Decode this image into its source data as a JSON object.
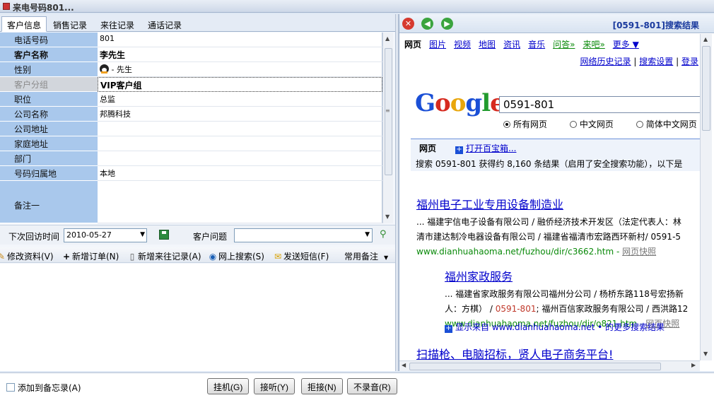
{
  "window": {
    "title": "来电号码801..."
  },
  "tabs": [
    {
      "label": "客户信息",
      "active": true
    },
    {
      "label": "销售记录",
      "active": false
    },
    {
      "label": "来往记录",
      "active": false
    },
    {
      "label": "通话记录",
      "active": false
    }
  ],
  "customer": {
    "phone": {
      "label": "电话号码",
      "value": "801"
    },
    "name": {
      "label": "客户名称",
      "value": "李先生"
    },
    "gender": {
      "label": "性别",
      "value": "- 先生"
    },
    "group": {
      "label": "客户分组",
      "value": "VIP客户组"
    },
    "title": {
      "label": "职位",
      "value": "总监"
    },
    "company": {
      "label": "公司名称",
      "value": "邦腾科技"
    },
    "company_address": {
      "label": "公司地址",
      "value": ""
    },
    "home_address": {
      "label": "家庭地址",
      "value": ""
    },
    "department": {
      "label": "部门",
      "value": ""
    },
    "location": {
      "label": "号码归属地",
      "value": "本地"
    },
    "note1": {
      "label": "备注一",
      "value": ""
    }
  },
  "followup": {
    "next_visit_label": "下次回访时间",
    "next_visit_value": "2010-05-27",
    "issue_label": "客户问题",
    "issue_value": ""
  },
  "toolbar": {
    "edit": "修改资料(V)",
    "new_order": "新增订单(N)",
    "new_record": "新增来往记录(A)",
    "web_search": "网上搜索(S)",
    "send_sms": "发送短信(F)",
    "common_notes": "常用备注"
  },
  "browser": {
    "header_title": "[0591-801]搜索结果",
    "nav": {
      "web": "网页",
      "images": "图片",
      "video": "视频",
      "maps": "地图",
      "news": "资讯",
      "music": "音乐",
      "qa": "问答»",
      "laiba": "来吧»",
      "more": "更多 ▼"
    },
    "history": "网络历史记录",
    "settings": "搜索设置",
    "login": "登录",
    "sep": "|",
    "query": "0591-801",
    "radio_all": "所有网页",
    "radio_cn": "中文网页",
    "radio_sc": "简体中文网页",
    "results_tab": "网页",
    "toolbox": "打开百宝箱...",
    "stats": "搜索  0591-801 获得约  8,160 条结果（启用了安全搜索功能），以下是",
    "results": [
      {
        "title": "福州电子工业专用设备制造业",
        "line1": "... 福建宇信电子设备有限公司  / 融侨经济技术开发区（法定代表人：林",
        "line2": "清市建达制冷电器设备有限公司  / 福建省福清市宏路西环新村/ 0591-5",
        "url": "www.dianhuahaoma.net/fuzhou/dir/c3662.htm",
        "cache": "网页快照"
      },
      {
        "title": "福州家政服务",
        "line1": "... 福建省家政服务有限公司福州分公司  / 杨桥东路118号宏扬新",
        "line2a": "人：方棋）  / ",
        "line2hl": "0591-801",
        "line2b": "; 福州百信家政服务有限公司  / 西洪路12",
        "url": "www.dianhuahaoma.net/fuzhou/dir/o821.htm",
        "cache": "网页快照"
      },
      {
        "title": "扫描枪、电脑招标，贤人电子商务平台!"
      }
    ],
    "more_results": "显示来自  www.dianhuahaoma.net • 的更多搜索结果"
  },
  "bottom": {
    "memo": "添加到备忘录(A)",
    "hangup": "挂机(G)",
    "answer": "接听(Y)",
    "reject": "拒接(N)",
    "norecord": "不录音(R)"
  }
}
